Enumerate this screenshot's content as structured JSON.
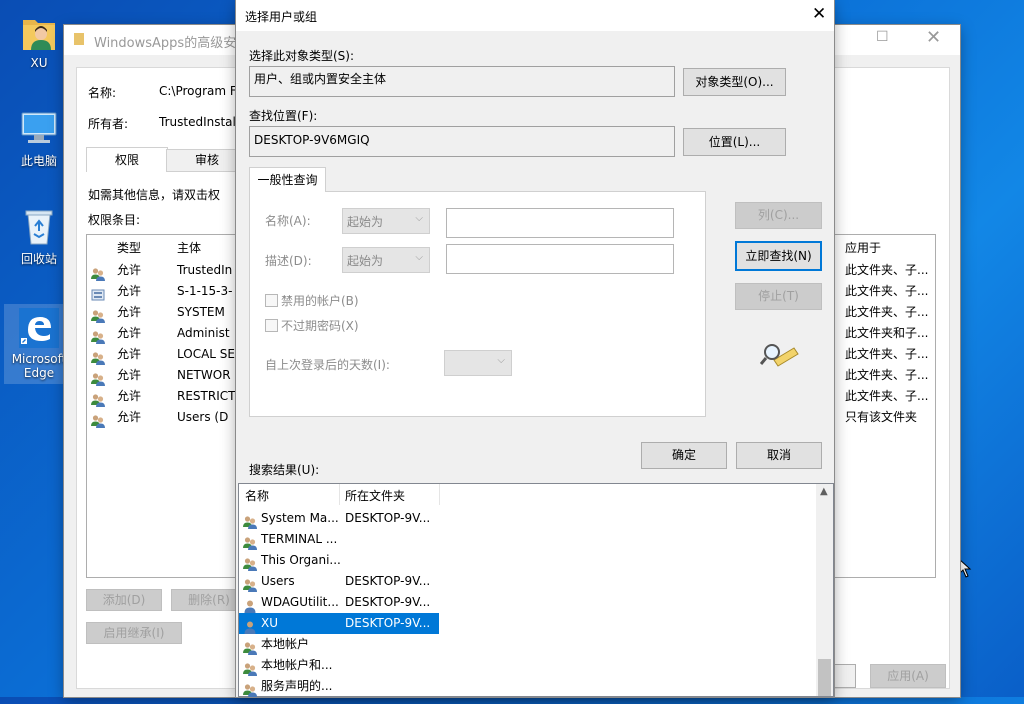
{
  "desktop": {
    "icons": [
      {
        "label": "XU",
        "icon": "user-folder-icon"
      },
      {
        "label": "此电脑",
        "icon": "computer-icon"
      },
      {
        "label": "回收站",
        "icon": "recycle-bin-icon"
      },
      {
        "label": "Microsoft Edge",
        "icon": "edge-icon"
      }
    ]
  },
  "bg_window": {
    "title": "WindowsApps的高级安全",
    "name_label": "名称:",
    "name_value": "C:\\Program F",
    "owner_label": "所有者:",
    "owner_value": "TrustedInstall",
    "tabs": [
      "权限",
      "审核"
    ],
    "info_text": "如需其他信息，请双击权",
    "entries_label": "权限条目:",
    "columns": {
      "type": "类型",
      "principal": "主体",
      "applies": "应用于"
    },
    "entries": [
      {
        "type": "允许",
        "principal": "TrustedIn",
        "applies": "此文件夹、子...",
        "icon": "users-icon"
      },
      {
        "type": "允许",
        "principal": "S-1-15-3-",
        "applies": "此文件夹、子...",
        "icon": "sid-icon"
      },
      {
        "type": "允许",
        "principal": "SYSTEM",
        "applies": "此文件夹、子...",
        "icon": "users-icon"
      },
      {
        "type": "允许",
        "principal": "Administ",
        "applies": "此文件夹和子...",
        "icon": "users-icon"
      },
      {
        "type": "允许",
        "principal": "LOCAL SE",
        "applies": "此文件夹、子...",
        "icon": "users-icon"
      },
      {
        "type": "允许",
        "principal": "NETWOR",
        "applies": "此文件夹、子...",
        "icon": "users-icon"
      },
      {
        "type": "允许",
        "principal": "RESTRICT",
        "applies": "此文件夹、子...",
        "icon": "users-icon"
      },
      {
        "type": "允许",
        "principal": "Users (D",
        "applies": "只有该文件夹",
        "icon": "users-icon"
      }
    ],
    "add_button": "添加(D)",
    "remove_button": "删除(R)",
    "inherit_button": "启用继承(I)",
    "apply_button": "应用(A)"
  },
  "dialog": {
    "title": "选择用户或组",
    "object_type_label": "选择此对象类型(S):",
    "object_type_value": "用户、组或内置安全主体",
    "object_types_button": "对象类型(O)...",
    "location_label": "查找位置(F):",
    "location_value": "DESKTOP-9V6MGIQ",
    "location_button": "位置(L)...",
    "tab_label": "一般性查询",
    "name_label": "名称(A):",
    "name_combo": "起始为",
    "desc_label": "描述(D):",
    "desc_combo": "起始为",
    "disabled_accounts": "禁用的帐户(B)",
    "non_expiring": "不过期密码(X)",
    "days_label": "自上次登录后的天数(I):",
    "columns_button": "列(C)...",
    "find_now_button": "立即查找(N)",
    "stop_button": "停止(T)",
    "ok_button": "确定",
    "cancel_button": "取消",
    "results_label": "搜索结果(U):",
    "results_columns": {
      "name": "名称",
      "folder": "所在文件夹"
    },
    "results": [
      {
        "name": "System Ma...",
        "folder": "DESKTOP-9V...",
        "icon": "group-icon",
        "selected": false
      },
      {
        "name": "TERMINAL ...",
        "folder": "",
        "icon": "group-icon",
        "selected": false
      },
      {
        "name": "This Organi...",
        "folder": "",
        "icon": "group-icon",
        "selected": false
      },
      {
        "name": "Users",
        "folder": "DESKTOP-9V...",
        "icon": "group-icon",
        "selected": false
      },
      {
        "name": "WDAGUtilit...",
        "folder": "DESKTOP-9V...",
        "icon": "user-icon",
        "selected": false
      },
      {
        "name": "XU",
        "folder": "DESKTOP-9V...",
        "icon": "user-icon",
        "selected": true
      },
      {
        "name": "本地帐户",
        "folder": "",
        "icon": "group-icon",
        "selected": false
      },
      {
        "name": "本地帐户和...",
        "folder": "",
        "icon": "group-icon",
        "selected": false
      },
      {
        "name": "服务声明的...",
        "folder": "",
        "icon": "group-icon",
        "selected": false
      }
    ]
  },
  "colors": {
    "accent": "#0078d7",
    "selection": "#0078d7",
    "desktop": "#0b6fd6"
  }
}
